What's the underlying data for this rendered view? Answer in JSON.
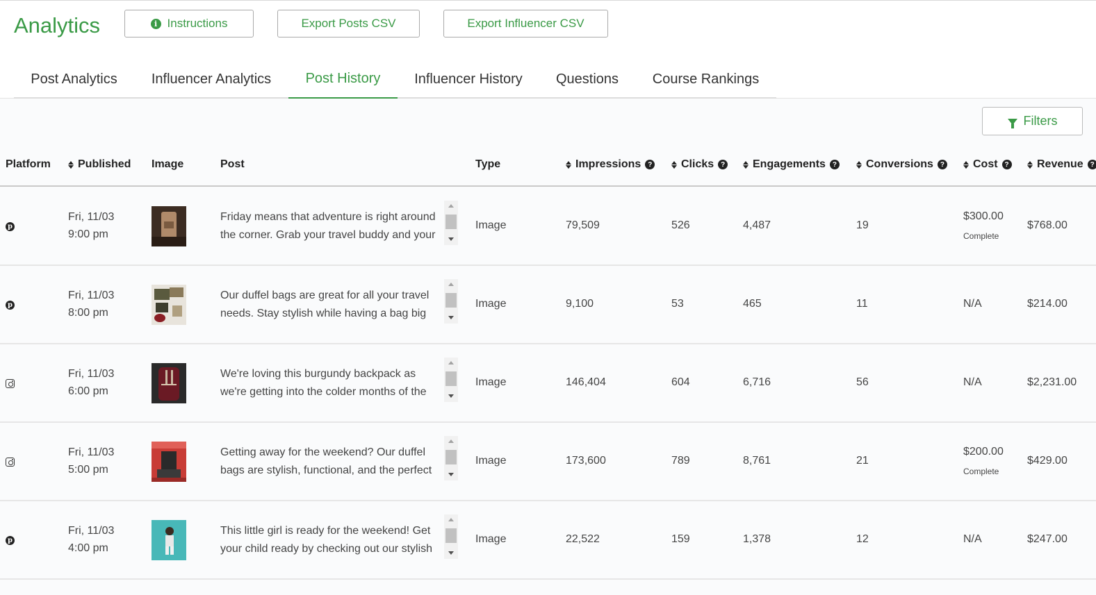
{
  "header": {
    "title": "Analytics",
    "buttons": {
      "instructions": "Instructions",
      "export_posts": "Export Posts CSV",
      "export_influencer": "Export Influencer CSV"
    }
  },
  "tabs": [
    "Post Analytics",
    "Influencer Analytics",
    "Post History",
    "Influencer History",
    "Questions",
    "Course Rankings"
  ],
  "active_tab": "Post History",
  "filters_label": "Filters",
  "table": {
    "columns": [
      "Platform",
      "Published",
      "Image",
      "Post",
      "Type",
      "Impressions",
      "Clicks",
      "Engagements",
      "Conversions",
      "Cost",
      "Revenue"
    ],
    "rows": [
      {
        "platform": "pinterest-icon",
        "date": "Fri, 11/03",
        "time": "9:00 pm",
        "post": "Friday means that adventure is right around the corner. Grab your travel buddy and your",
        "type": "Image",
        "impressions": "79,509",
        "clicks": "526",
        "engagements": "4,487",
        "conversions": "19",
        "cost": "$300.00",
        "cost_status": "Complete",
        "revenue": "$768.00"
      },
      {
        "platform": "pinterest-icon",
        "date": "Fri, 11/03",
        "time": "8:00 pm",
        "post": "Our duffel bags are great for all your travel needs. Stay stylish while having a bag big",
        "type": "Image",
        "impressions": "9,100",
        "clicks": "53",
        "engagements": "465",
        "conversions": "11",
        "cost": "N/A",
        "cost_status": "",
        "revenue": "$214.00"
      },
      {
        "platform": "instagram-icon",
        "date": "Fri, 11/03",
        "time": "6:00 pm",
        "post": "We're loving this burgundy backpack as we're getting into the colder months of the",
        "type": "Image",
        "impressions": "146,404",
        "clicks": "604",
        "engagements": "6,716",
        "conversions": "56",
        "cost": "N/A",
        "cost_status": "",
        "revenue": "$2,231.00"
      },
      {
        "platform": "instagram-icon",
        "date": "Fri, 11/03",
        "time": "5:00 pm",
        "post": "Getting away for the weekend? Our duffel bags are stylish, functional, and the perfect",
        "type": "Image",
        "impressions": "173,600",
        "clicks": "789",
        "engagements": "8,761",
        "conversions": "21",
        "cost": "$200.00",
        "cost_status": "Complete",
        "revenue": "$429.00"
      },
      {
        "platform": "pinterest-icon",
        "date": "Fri, 11/03",
        "time": "4:00 pm",
        "post": "This little girl is ready for the weekend! Get your child ready by checking out our stylish",
        "type": "Image",
        "impressions": "22,522",
        "clicks": "159",
        "engagements": "1,378",
        "conversions": "12",
        "cost": "N/A",
        "cost_status": "",
        "revenue": "$247.00"
      }
    ]
  },
  "colors": {
    "accent": "#3a9a46",
    "background": "#fafbfc",
    "border": "#e6e6e6"
  }
}
